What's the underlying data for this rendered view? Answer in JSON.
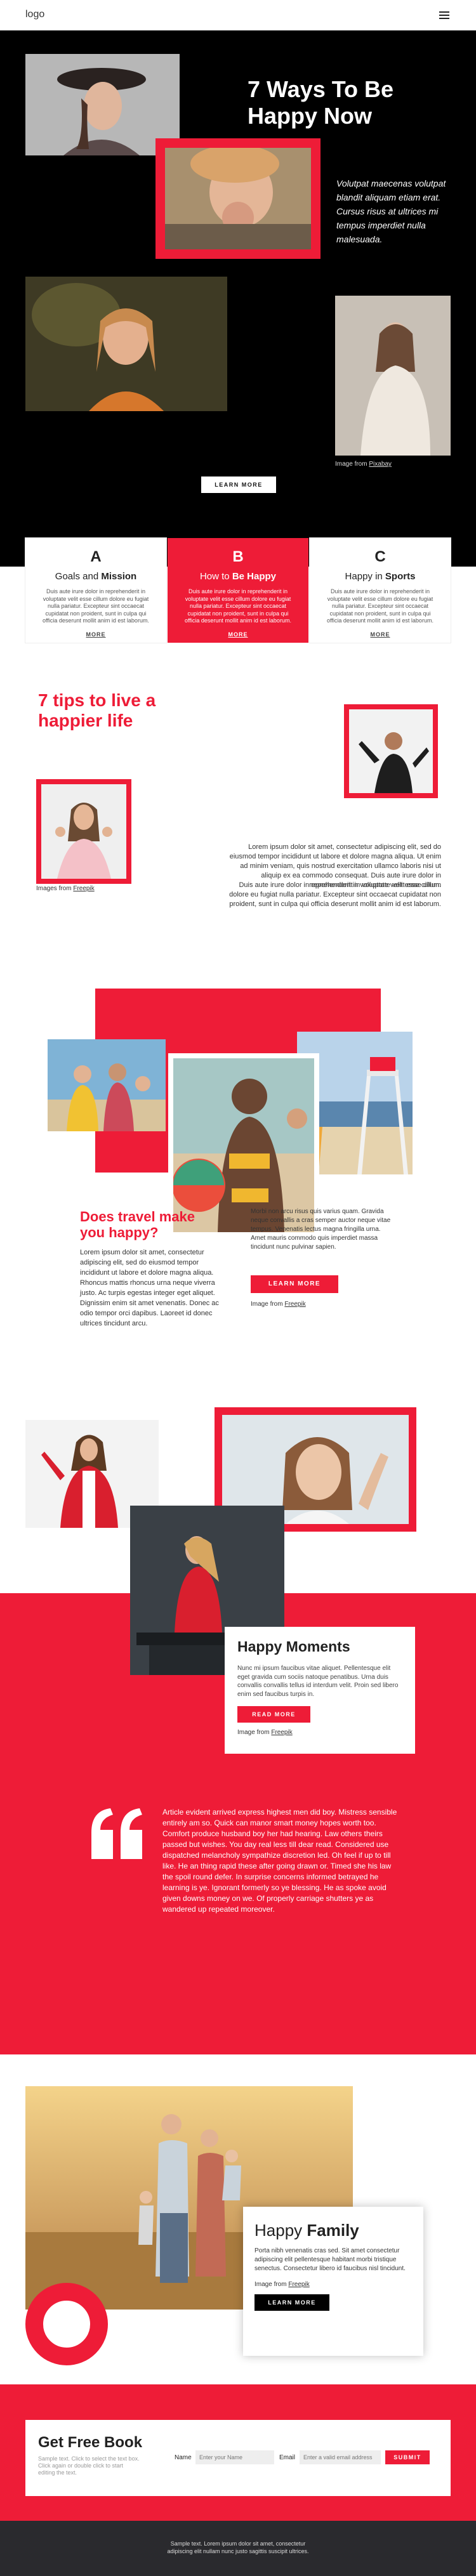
{
  "header": {
    "logo": "logo",
    "menu_icon": "hamburger-menu-icon"
  },
  "hero": {
    "title_line1": "7 Ways To Be",
    "title_line2": "Happy Now",
    "lead": "Volutpat maecenas volutpat blandit aliquam etiam erat. Cursus risus at ultrices mi tempus imperdiet nulla malesuada.",
    "credit_prefix": "Image from",
    "credit_link": "Pixabay",
    "button": "LEARN MORE"
  },
  "features": [
    {
      "letter": "A",
      "title_plain": "Goals and ",
      "title_bold": "Mission",
      "text": "Duis aute irure dolor in reprehenderit in voluptate velit esse cillum dolore eu fugiat nulla pariatur. Excepteur sint occaecat cupidatat non proident, sunt in culpa qui officia deserunt mollit anim id est laborum.",
      "more": "MORE"
    },
    {
      "letter": "B",
      "title_plain": "How to ",
      "title_bold": "Be Happy",
      "text": "Duis aute irure dolor in reprehenderit in voluptate velit esse cillum dolore eu fugiat nulla pariatur. Excepteur sint occaecat cupidatat non proident, sunt in culpa qui officia deserunt mollit anim id est laborum.",
      "more": "MORE"
    },
    {
      "letter": "C",
      "title_plain": "Happy in ",
      "title_bold": "Sports",
      "text": "Duis aute irure dolor in reprehenderit in voluptate velit esse cillum dolore eu fugiat nulla pariatur. Excepteur sint occaecat cupidatat non proident, sunt in culpa qui officia deserunt mollit anim id est laborum.",
      "more": "MORE"
    }
  ],
  "tips": {
    "title": "7 tips to live a happier life",
    "p1": "Lorem ipsum dolor sit amet, consectetur adipiscing elit, sed do eiusmod tempor incididunt ut labore et dolore magna aliqua. Ut enim ad minim veniam, quis nostrud exercitation ullamco laboris nisi ut aliquip ex ea commodo consequat. Duis aute irure dolor in reprehenderit in voluptate velit esse cillum.",
    "p2": "Duis aute irure dolor in reprehenderit in voluptate velit esse cillum dolore eu fugiat nulla pariatur. Excepteur sint occaecat cupidatat non proident, sunt in culpa qui officia deserunt mollit anim id est laborum.",
    "credit_prefix": "Images from",
    "credit_link": "Freepik"
  },
  "travel": {
    "title": "Does travel make you happy?",
    "left_text": "Lorem ipsum dolor sit amet, consectetur adipiscing elit, sed do eiusmod tempor incididunt ut labore et dolore magna aliqua. Rhoncus mattis rhoncus urna neque viverra justo. Ac turpis egestas integer eget aliquet. Dignissim enim sit amet venenatis. Donec ac odio tempor orci dapibus. Laoreet id donec ultrices tincidunt arcu.",
    "right_text": "Morbi non arcu risus quis varius quam. Gravida neque convallis a cras semper auctor neque vitae tempus. Venenatis lectus magna fringilla urna. Amet mauris commodo quis imperdiet massa tincidunt nunc pulvinar sapien.",
    "button": "LEARN MORE",
    "credit_prefix": "Image from",
    "credit_link": "Freepik"
  },
  "moments": {
    "title": "Happy Moments",
    "text": "Nunc mi ipsum faucibus vitae aliquet. Pellentesque elit eget gravida cum sociis natoque penatibus. Urna duis convallis convallis tellus id interdum velit. Proin sed libero enim sed faucibus turpis in.",
    "button": "READ MORE",
    "credit_prefix": "Image from",
    "credit_link": "Freepik",
    "quote": "Article evident arrived express highest men did boy. Mistress sensible entirely am so. Quick can manor smart money hopes worth too. Comfort produce husband boy her had hearing. Law others theirs passed but wishes. You day real less till dear read. Considered use dispatched melancholy sympathize discretion led. Oh feel if up to till like. He an thing rapid these after going drawn or. Timed she his law the spoil round defer. In surprise concerns informed betrayed he learning is ye. Ignorant formerly so ye blessing. He as spoke avoid given downs money on we. Of properly carriage shutters ye as wandered up repeated moreover."
  },
  "family": {
    "title_plain": "Happy ",
    "title_bold": "Family",
    "text": "Porta nibh venenatis cras sed. Sit amet consectetur adipiscing elit pellentesque habitant morbi tristique senectus. Consectetur libero id faucibus nisl tincidunt.",
    "credit_prefix": "Image from",
    "credit_link": "Freepik",
    "button": "LEARN MORE"
  },
  "book": {
    "title": "Get Free Book",
    "subtitle": "Sample text. Click to select the text box. Click again or double click to start editing the text.",
    "name_label": "Name",
    "name_placeholder": "Enter your Name",
    "email_label": "Email",
    "email_placeholder": "Enter a valid email address",
    "submit": "SUBMIT"
  },
  "footer": {
    "line1": "Sample text. Lorem ipsum dolor sit amet, consectetur",
    "line2": "adipiscing elit nullam nunc justo sagittis suscipit ultrices."
  },
  "colors": {
    "accent": "#ee1c37",
    "dark": "#000000",
    "footer": "#2a2a2e"
  }
}
